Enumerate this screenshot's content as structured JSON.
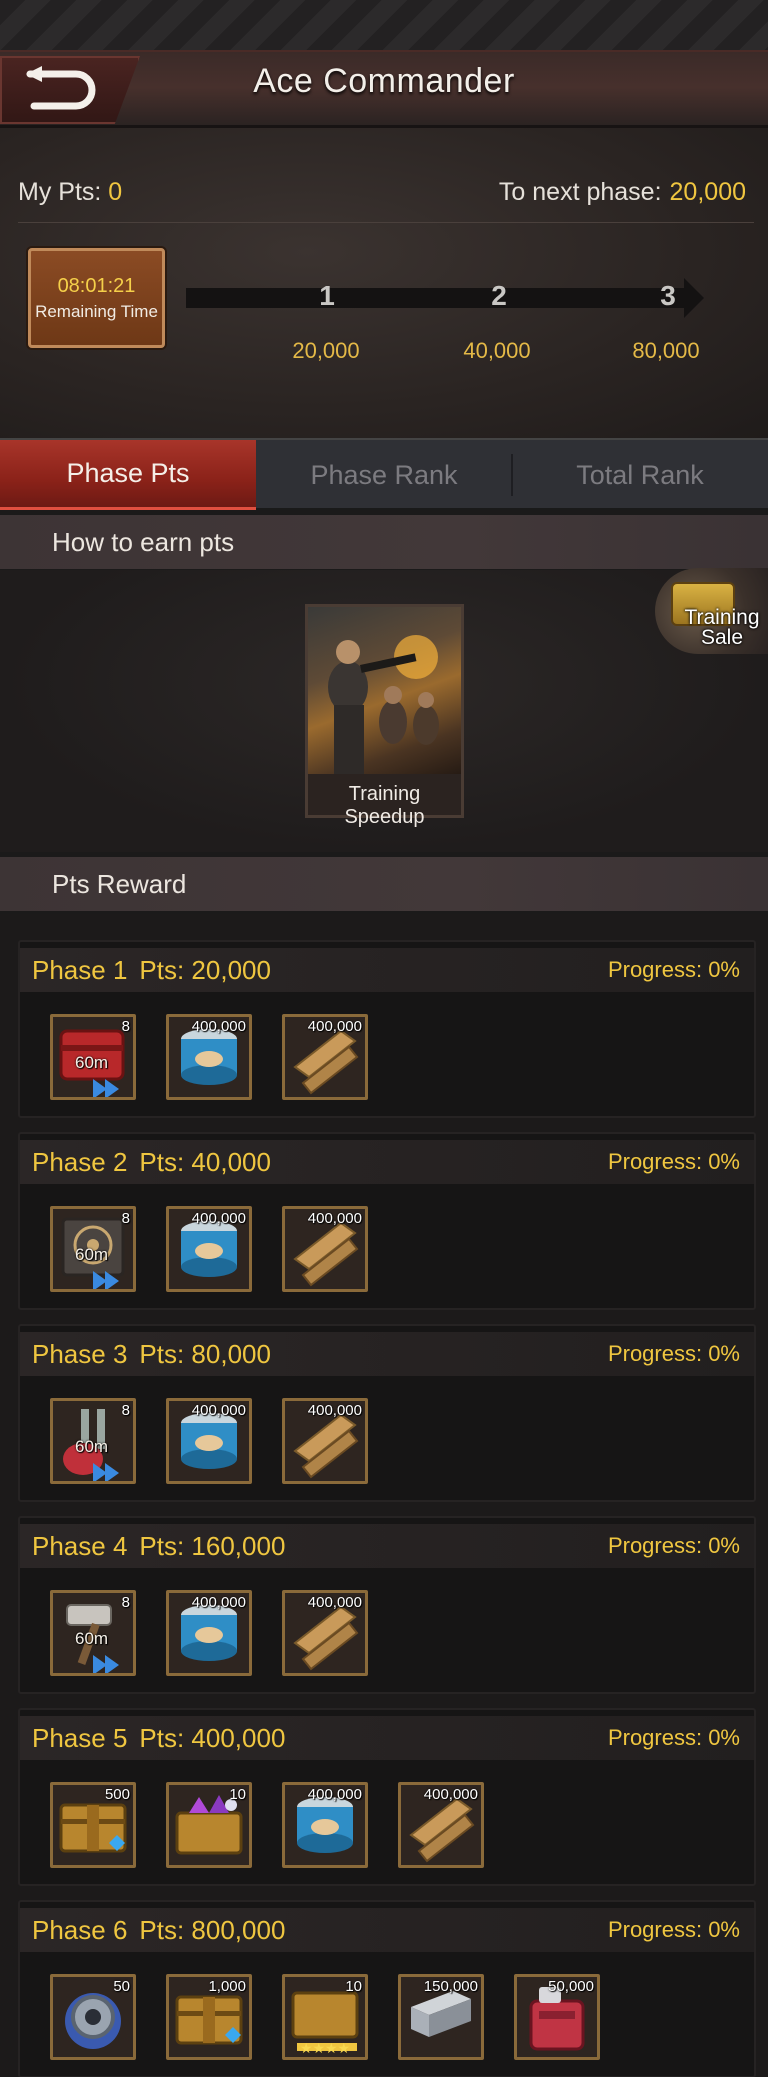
{
  "header": {
    "title": "Ace Commander",
    "my_pts_label": "My Pts:",
    "my_pts_value": "0",
    "next_phase_label": "To next phase:",
    "next_phase_value": "20,000"
  },
  "timer": {
    "value": "08:01:21",
    "label": "Remaining Time"
  },
  "milestones": [
    {
      "node": "1",
      "value": "20,000"
    },
    {
      "node": "2",
      "value": "40,000"
    },
    {
      "node": "3",
      "value": "80,000"
    }
  ],
  "tabs": [
    {
      "label": "Phase Pts",
      "active": true
    },
    {
      "label": "Phase Rank",
      "active": false
    },
    {
      "label": "Total Rank",
      "active": false
    }
  ],
  "earn": {
    "heading": "How to earn pts",
    "card_label": "Training Speedup",
    "sale_label_line1": "Training",
    "sale_label_line2": "Sale"
  },
  "rewards_heading": "Pts Reward",
  "phases": [
    {
      "phase": "Phase 1",
      "pts": "Pts: 20,000",
      "progress": "Progress: 0%",
      "items": [
        {
          "icon": "red-speedup-box-icon",
          "count": "8",
          "time": "60m"
        },
        {
          "icon": "food-can-icon",
          "count": "400,000"
        },
        {
          "icon": "wood-planks-icon",
          "count": "400,000"
        }
      ]
    },
    {
      "phase": "Phase 2",
      "pts": "Pts: 40,000",
      "progress": "Progress: 0%",
      "items": [
        {
          "icon": "training-speedup-icon",
          "count": "8",
          "time": "60m"
        },
        {
          "icon": "food-can-icon",
          "count": "400,000"
        },
        {
          "icon": "wood-planks-icon",
          "count": "400,000"
        }
      ]
    },
    {
      "phase": "Phase 3",
      "pts": "Pts: 80,000",
      "progress": "Progress: 0%",
      "items": [
        {
          "icon": "research-speedup-icon",
          "count": "8",
          "time": "60m"
        },
        {
          "icon": "food-can-icon",
          "count": "400,000"
        },
        {
          "icon": "wood-planks-icon",
          "count": "400,000"
        }
      ]
    },
    {
      "phase": "Phase 4",
      "pts": "Pts: 160,000",
      "progress": "Progress: 0%",
      "items": [
        {
          "icon": "build-speedup-icon",
          "count": "8",
          "time": "60m"
        },
        {
          "icon": "food-can-icon",
          "count": "400,000"
        },
        {
          "icon": "wood-planks-icon",
          "count": "400,000"
        }
      ]
    },
    {
      "phase": "Phase 5",
      "pts": "Pts: 400,000",
      "progress": "Progress: 0%",
      "items": [
        {
          "icon": "gem-chest-icon",
          "count": "500"
        },
        {
          "icon": "purple-gem-chest-icon",
          "count": "10"
        },
        {
          "icon": "food-can-icon",
          "count": "400,000"
        },
        {
          "icon": "wood-planks-icon",
          "count": "400,000"
        }
      ]
    },
    {
      "phase": "Phase 6",
      "pts": "Pts: 800,000",
      "progress": "Progress: 0%",
      "items": [
        {
          "icon": "gear-part-icon",
          "count": "50"
        },
        {
          "icon": "gem-chest-icon",
          "count": "1,000"
        },
        {
          "icon": "star-chest-icon",
          "count": "10"
        },
        {
          "icon": "steel-beam-icon",
          "count": "150,000"
        },
        {
          "icon": "fuel-can-icon",
          "count": "50,000"
        }
      ]
    }
  ],
  "colors": {
    "accent_gold": "#efc640",
    "tab_active": "#a8352a",
    "item_border": "#8a6a3a"
  }
}
